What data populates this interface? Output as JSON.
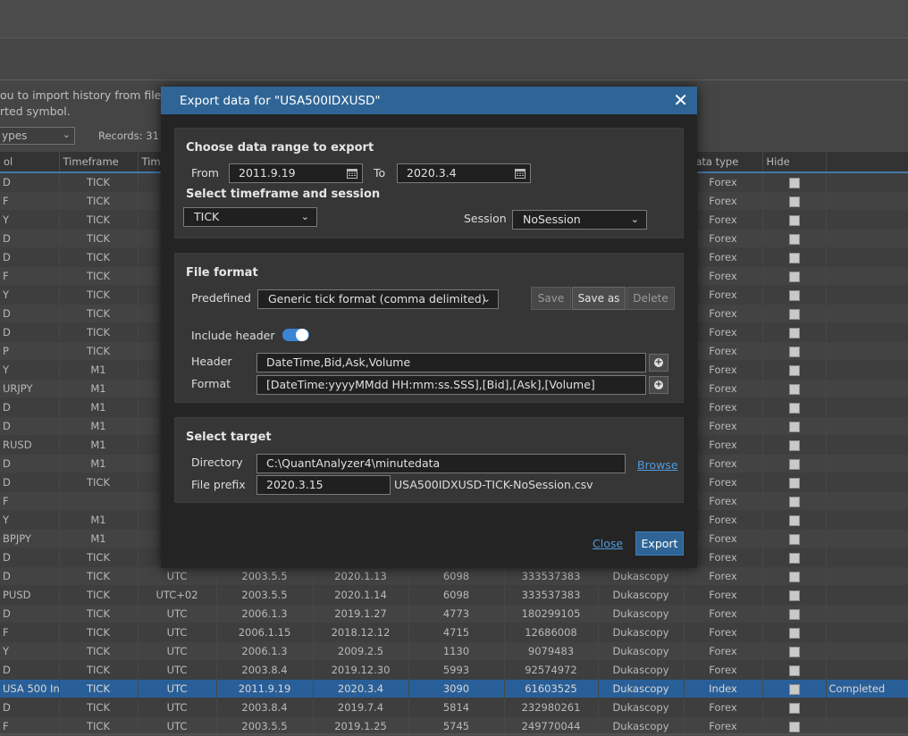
{
  "background": {
    "info_line1": "ou to import history from files, o",
    "info_line2": "rted symbol.",
    "type_filter": "ypes",
    "records": "Records: 31",
    "columns": [
      "ol",
      "Timeframe",
      "Tim",
      "",
      "",
      "",
      "",
      "",
      "Data type",
      "Hide",
      ""
    ],
    "rows": [
      {
        "sym": "D",
        "tf": "TICK",
        "tz": "",
        "from": "",
        "to": "",
        "days": "",
        "ticks": "",
        "src": "",
        "type": "Forex",
        "status": ""
      },
      {
        "sym": "F",
        "tf": "TICK",
        "tz": "",
        "from": "",
        "to": "",
        "days": "",
        "ticks": "",
        "src": "",
        "type": "Forex",
        "status": ""
      },
      {
        "sym": "Y",
        "tf": "TICK",
        "tz": "",
        "from": "",
        "to": "",
        "days": "",
        "ticks": "",
        "src": "",
        "type": "Forex",
        "status": ""
      },
      {
        "sym": "D",
        "tf": "TICK",
        "tz": "",
        "from": "",
        "to": "",
        "days": "",
        "ticks": "",
        "src": "",
        "type": "Forex",
        "status": ""
      },
      {
        "sym": "D",
        "tf": "TICK",
        "tz": "",
        "from": "",
        "to": "",
        "days": "",
        "ticks": "",
        "src": "",
        "type": "Forex",
        "status": ""
      },
      {
        "sym": "F",
        "tf": "TICK",
        "tz": "",
        "from": "",
        "to": "",
        "days": "",
        "ticks": "",
        "src": "",
        "type": "Forex",
        "status": ""
      },
      {
        "sym": "Y",
        "tf": "TICK",
        "tz": "",
        "from": "",
        "to": "",
        "days": "",
        "ticks": "",
        "src": "",
        "type": "Forex",
        "status": ""
      },
      {
        "sym": "D",
        "tf": "TICK",
        "tz": "",
        "from": "",
        "to": "",
        "days": "",
        "ticks": "",
        "src": "",
        "type": "Forex",
        "status": ""
      },
      {
        "sym": "D",
        "tf": "TICK",
        "tz": "",
        "from": "",
        "to": "",
        "days": "",
        "ticks": "",
        "src": "",
        "type": "Forex",
        "status": ""
      },
      {
        "sym": "P",
        "tf": "TICK",
        "tz": "",
        "from": "",
        "to": "",
        "days": "",
        "ticks": "",
        "src": "",
        "type": "Forex",
        "status": ""
      },
      {
        "sym": "Y",
        "tf": "M1",
        "tz": "",
        "from": "",
        "to": "",
        "days": "",
        "ticks": "",
        "src": "",
        "type": "Forex",
        "status": ""
      },
      {
        "sym": "URJPY",
        "tf": "M1",
        "tz": "",
        "from": "",
        "to": "",
        "days": "",
        "ticks": "",
        "src": "",
        "type": "Forex",
        "status": ""
      },
      {
        "sym": "D",
        "tf": "M1",
        "tz": "",
        "from": "",
        "to": "",
        "days": "",
        "ticks": "",
        "src": "",
        "type": "Forex",
        "status": ""
      },
      {
        "sym": "D",
        "tf": "M1",
        "tz": "",
        "from": "",
        "to": "",
        "days": "",
        "ticks": "",
        "src": "",
        "type": "Forex",
        "status": ""
      },
      {
        "sym": "RUSD",
        "tf": "M1",
        "tz": "",
        "from": "",
        "to": "",
        "days": "",
        "ticks": "",
        "src": "",
        "type": "Forex",
        "status": ""
      },
      {
        "sym": "D",
        "tf": "M1",
        "tz": "",
        "from": "",
        "to": "",
        "days": "",
        "ticks": "",
        "src": "",
        "type": "Forex",
        "status": ""
      },
      {
        "sym": "D",
        "tf": "TICK",
        "tz": "",
        "from": "",
        "to": "",
        "days": "",
        "ticks": "",
        "src": "",
        "type": "Forex",
        "status": ""
      },
      {
        "sym": "F",
        "tf": "",
        "tz": "",
        "from": "",
        "to": "",
        "days": "",
        "ticks": "",
        "src": "",
        "type": "Forex",
        "status": ""
      },
      {
        "sym": "Y",
        "tf": "M1",
        "tz": "",
        "from": "",
        "to": "",
        "days": "",
        "ticks": "",
        "src": "",
        "type": "Forex",
        "status": ""
      },
      {
        "sym": "BPJPY",
        "tf": "M1",
        "tz": "",
        "from": "",
        "to": "",
        "days": "",
        "ticks": "",
        "src": "",
        "type": "Forex",
        "status": ""
      },
      {
        "sym": "D",
        "tf": "TICK",
        "tz": "",
        "from": "",
        "to": "",
        "days": "",
        "ticks": "",
        "src": "",
        "type": "Forex",
        "status": ""
      },
      {
        "sym": "D",
        "tf": "TICK",
        "tz": "UTC",
        "from": "2003.5.5",
        "to": "2020.1.13",
        "days": "6098",
        "ticks": "333537383",
        "src": "Dukascopy",
        "type": "Forex",
        "status": ""
      },
      {
        "sym": "PUSD",
        "tf": "TICK",
        "tz": "UTC+02",
        "from": "2003.5.5",
        "to": "2020.1.14",
        "days": "6098",
        "ticks": "333537383",
        "src": "Dukascopy",
        "type": "Forex",
        "status": ""
      },
      {
        "sym": "D",
        "tf": "TICK",
        "tz": "UTC",
        "from": "2006.1.3",
        "to": "2019.1.27",
        "days": "4773",
        "ticks": "180299105",
        "src": "Dukascopy",
        "type": "Forex",
        "status": ""
      },
      {
        "sym": "F",
        "tf": "TICK",
        "tz": "UTC",
        "from": "2006.1.15",
        "to": "2018.12.12",
        "days": "4715",
        "ticks": "12686008",
        "src": "Dukascopy",
        "type": "Forex",
        "status": ""
      },
      {
        "sym": "Y",
        "tf": "TICK",
        "tz": "UTC",
        "from": "2006.1.3",
        "to": "2009.2.5",
        "days": "1130",
        "ticks": "9079483",
        "src": "Dukascopy",
        "type": "Forex",
        "status": ""
      },
      {
        "sym": "D",
        "tf": "TICK",
        "tz": "UTC",
        "from": "2003.8.4",
        "to": "2019.12.30",
        "days": "5993",
        "ticks": "92574972",
        "src": "Dukascopy",
        "type": "Forex",
        "status": ""
      },
      {
        "sym": "USA 500 In...",
        "tf": "TICK",
        "tz": "UTC",
        "from": "2011.9.19",
        "to": "2020.3.4",
        "days": "3090",
        "ticks": "61603525",
        "src": "Dukascopy",
        "type": "Index",
        "status": "Completed",
        "selected": true
      },
      {
        "sym": "D",
        "tf": "TICK",
        "tz": "UTC",
        "from": "2003.8.4",
        "to": "2019.7.4",
        "days": "5814",
        "ticks": "232980261",
        "src": "Dukascopy",
        "type": "Forex",
        "status": ""
      },
      {
        "sym": "F",
        "tf": "TICK",
        "tz": "UTC",
        "from": "2003.5.5",
        "to": "2019.1.25",
        "days": "5745",
        "ticks": "249770044",
        "src": "Dukascopy",
        "type": "Forex",
        "status": ""
      }
    ]
  },
  "dialog": {
    "title": "Export data for \"USA500IDXUSD\"",
    "range": {
      "heading": "Choose data range to export",
      "from_label": "From",
      "from_value": "2011.9.19",
      "to_label": "To",
      "to_value": "2020.3.4"
    },
    "timeframe": {
      "heading": "Select timeframe and session",
      "timeframe_value": "TICK",
      "session_label": "Session",
      "session_value": "NoSession"
    },
    "file_format": {
      "heading": "File format",
      "predefined_label": "Predefined",
      "predefined_value": "Generic tick format (comma delimited)",
      "save_label": "Save",
      "save_as_label": "Save as",
      "delete_label": "Delete",
      "include_header_label": "Include header",
      "include_header_on": true,
      "header_label": "Header",
      "header_value": "DateTime,Bid,Ask,Volume",
      "format_label": "Format",
      "format_value": "[DateTime:yyyyMMdd HH:mm:ss.SSS],[Bid],[Ask],[Volume]"
    },
    "target": {
      "heading": "Select target",
      "directory_label": "Directory",
      "directory_value": "C:\\QuantAnalyzer4\\minutedata",
      "browse_label": "Browse",
      "prefix_label": "File prefix",
      "prefix_value": "2020.3.15",
      "filename_preview": "USA500IDXUSD-TICK-NoSession.csv"
    },
    "close_label": "Close",
    "export_label": "Export"
  },
  "colors": {
    "accent": "#2f6596",
    "toggle_on": "#3b84d4",
    "link": "#4f9be0",
    "selected_row": "#3272b6"
  }
}
